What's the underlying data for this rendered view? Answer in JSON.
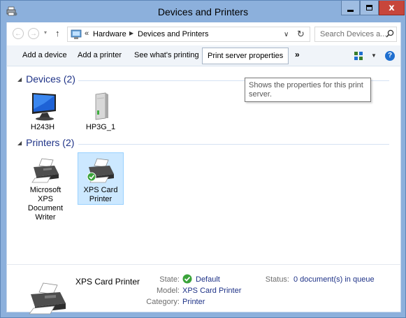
{
  "window": {
    "title": "Devices and Printers",
    "controls": {
      "minimize": "—",
      "maximize": "□",
      "close": "x"
    }
  },
  "address": {
    "chevron": "«",
    "crumbs": [
      "Hardware",
      "Devices and Printers"
    ],
    "separator": "▶",
    "dropdown": "∨",
    "refresh": "↻",
    "back": "←",
    "forward": "→",
    "recent": "▾",
    "up": "↑"
  },
  "search": {
    "placeholder": "Search Devices a..."
  },
  "commands": {
    "add_device": "Add a device",
    "add_printer": "Add a printer",
    "see_printing": "See what's printing",
    "print_server": "Print server properties",
    "more": "»",
    "view_dd": "▼",
    "help": "?"
  },
  "tooltip": {
    "text": "Shows the properties for this print server."
  },
  "groups": {
    "devices": {
      "header": "Devices (2)",
      "items": [
        {
          "label": "H243H",
          "icon": "monitor-icon"
        },
        {
          "label": "HP3G_1",
          "icon": "computer-tower-icon"
        }
      ]
    },
    "printers": {
      "header": "Printers (2)",
      "items": [
        {
          "label": "Microsoft XPS Document Writer",
          "icon": "printer-icon"
        },
        {
          "label": "XPS Card Printer",
          "icon": "printer-default-icon",
          "selected": true
        }
      ]
    },
    "collapse_glyph": "◢"
  },
  "details": {
    "name": "XPS Card Printer",
    "state_label": "State:",
    "state_value": "Default",
    "model_label": "Model:",
    "model_value": "XPS Card Printer",
    "category_label": "Category:",
    "category_value": "Printer",
    "status_label": "Status:",
    "status_value": "0 document(s) in queue"
  },
  "colors": {
    "frame": "#8cb0dc",
    "close": "#c7463b",
    "group_header": "#1e3287",
    "selection": "#cce8ff"
  }
}
